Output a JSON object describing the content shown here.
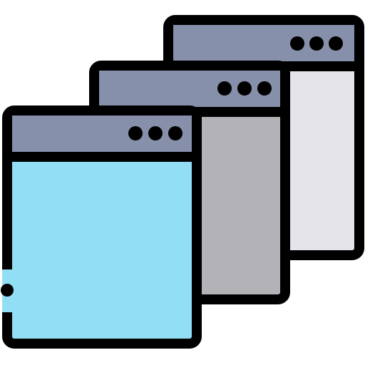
{
  "icon": {
    "name": "stacked-windows-icon",
    "colors": {
      "outline": "#000000",
      "titlebar": "#8690AA",
      "window_front": "#92DEF5",
      "window_middle": "#B3B2B6",
      "window_back": "#E4E4EA",
      "background": "#FFFFFF"
    },
    "windows": [
      {
        "id": "back",
        "content_color_key": "window_back",
        "dots": 3
      },
      {
        "id": "middle",
        "content_color_key": "window_middle",
        "dots": 3
      },
      {
        "id": "front",
        "content_color_key": "window_front",
        "dots": 3
      }
    ]
  }
}
